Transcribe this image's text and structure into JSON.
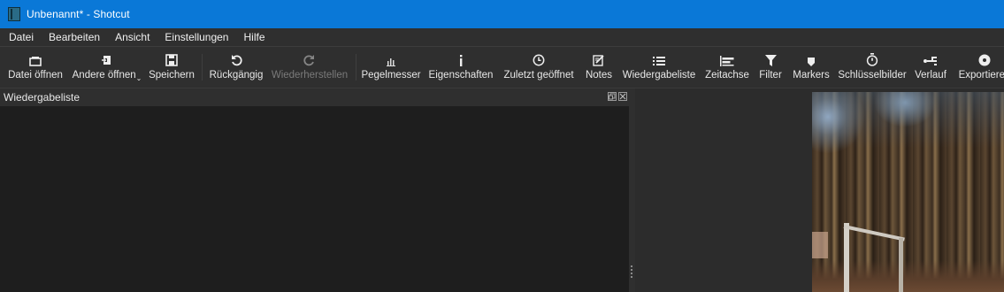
{
  "window": {
    "title": "Unbenannt* - Shotcut",
    "title_color": "#0a78d7"
  },
  "menu": [
    {
      "label": "Datei"
    },
    {
      "label": "Bearbeiten"
    },
    {
      "label": "Ansicht"
    },
    {
      "label": "Einstellungen"
    },
    {
      "label": "Hilfe"
    }
  ],
  "toolbar": {
    "open_file": {
      "label": "Datei öffnen",
      "icon": "open-file-icon"
    },
    "open_other": {
      "label": "Andere öffnen",
      "icon": "open-other-icon"
    },
    "save": {
      "label": "Speichern",
      "icon": "save-icon"
    },
    "undo": {
      "label": "Rückgängig",
      "icon": "undo-icon"
    },
    "redo": {
      "label": "Wiederherstellen",
      "icon": "redo-icon",
      "enabled": false
    },
    "peak_meter": {
      "label": "Pegelmesser",
      "icon": "peak-meter-icon"
    },
    "properties": {
      "label": "Eigenschaften",
      "icon": "info-icon"
    },
    "recent": {
      "label": "Zuletzt geöffnet",
      "icon": "clock-icon"
    },
    "notes": {
      "label": "Notes",
      "icon": "notes-icon"
    },
    "playlist": {
      "label": "Wiedergabeliste",
      "icon": "list-icon"
    },
    "timeline": {
      "label": "Zeitachse",
      "icon": "timeline-icon"
    },
    "filter": {
      "label": "Filter",
      "icon": "filter-icon"
    },
    "markers": {
      "label": "Markers",
      "icon": "marker-icon"
    },
    "keyframes": {
      "label": "Schlüsselbilder",
      "icon": "stopwatch-icon"
    },
    "history": {
      "label": "Verlauf",
      "icon": "history-icon"
    },
    "export": {
      "label": "Exportieren",
      "icon": "export-icon"
    }
  },
  "playlist_panel": {
    "title": "Wiedergabeliste"
  }
}
